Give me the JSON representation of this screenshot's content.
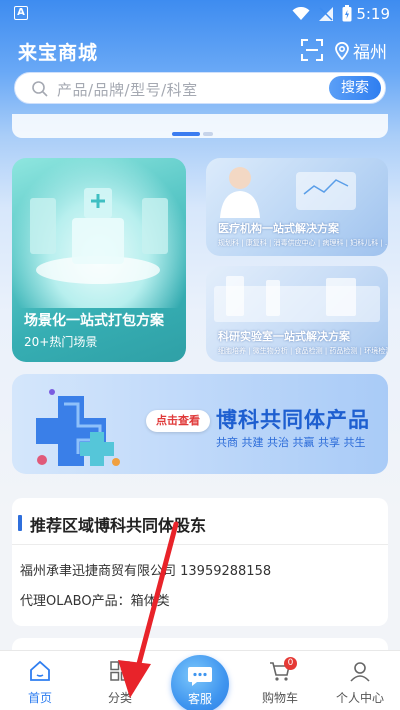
{
  "status_bar": {
    "time": "5:19",
    "badge": "A"
  },
  "header": {
    "app_title": "来宝商城",
    "location": "福州"
  },
  "search": {
    "placeholder": "产品/品牌/型号/科室",
    "button_label": "搜索"
  },
  "cards": {
    "scene_package": {
      "title": "场景化一站式打包方案",
      "subtitle": "20+热门场景"
    },
    "medical_institution": {
      "title": "医疗机构一站式解决方案",
      "tags": "规划科 | 康复科 | 消毒供应中心 | 病理科 | 妇科儿科 | ..."
    },
    "research_lab": {
      "title": "科研实验室一站式解决方案",
      "tags": "细胞培养 | 微生物分析 | 食品检测 | 药品检测 | 环境检测 | ..."
    }
  },
  "promo": {
    "cta": "点击查看",
    "title": "博科共同体产品",
    "subtitle": "共商  共建  共治  共赢  共享  共生"
  },
  "recommend": {
    "title": "推荐区域博科共同体股东",
    "company": "福州承聿迅捷商贸有限公司 13959288158",
    "agency": "代理OLABO产品：箱体类"
  },
  "tabbar": {
    "home": "首页",
    "category": "分类",
    "service": "客服",
    "cart": "购物车",
    "cart_count": "0",
    "profile": "个人中心"
  },
  "colors": {
    "accent": "#2f7ef0",
    "header": "#3e8cf0",
    "badge": "#e53935",
    "arrow": "#e8232a"
  }
}
